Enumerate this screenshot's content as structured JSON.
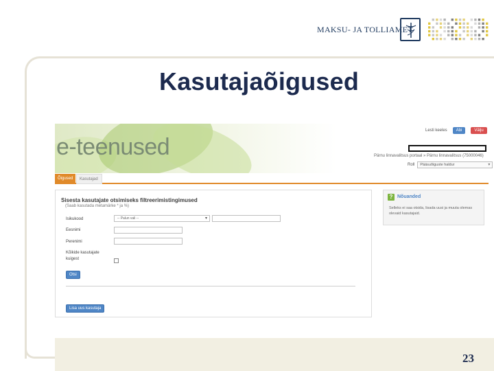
{
  "slide": {
    "logo_text": "MAKSU- JA TOLLIAMET",
    "title": "Kasutajaõigused",
    "page_number": "23",
    "dot_colors": [
      "#c7c7c7",
      "#e0c640",
      "#7f7f7f",
      "#b3b3b3",
      "#d9d9d9",
      "#e6d27a"
    ]
  },
  "app": {
    "brand": "e-teenused",
    "header": {
      "login_label": "Lesti keeles",
      "btn_blue_label": "Abi",
      "btn_red_label": "Välju",
      "portal_text": "Pärnu linnavalitsus portaal » Pärnu linnavalitsus (75000046)",
      "role_label": "Roll",
      "role_value": "Pääsuõiguste haldur"
    },
    "tabs": [
      {
        "label": "Õigused",
        "active": true
      },
      {
        "label": "Kasutajad",
        "active": false
      }
    ],
    "search_panel": {
      "title": "Sisesta kasutajate otsimiseks filtreerimistingimused",
      "subtitle": "(Saab kasutada metamärke * ja %)",
      "isikukood_label": "Isikukood",
      "isikukood_select_value": "-- Palun vali --",
      "eesnimi_label": "Eesnimi",
      "perenimi_label": "Perenimi",
      "all_users_label_line1": "Kõikide kasutajate",
      "all_users_label_line2": "kuigest",
      "search_button": "Otsi",
      "add_user_button": "Lisa uus kasutaja"
    },
    "help_panel": {
      "title": "Nõuanded",
      "text": "Selleks ei saa otsida, lisada uusi ja muuta olemas olevaid kasutajaid."
    },
    "colors": {
      "accent_orange": "#e08a2a",
      "button_blue": "#4f86c6",
      "help_green": "#7db53f"
    }
  }
}
